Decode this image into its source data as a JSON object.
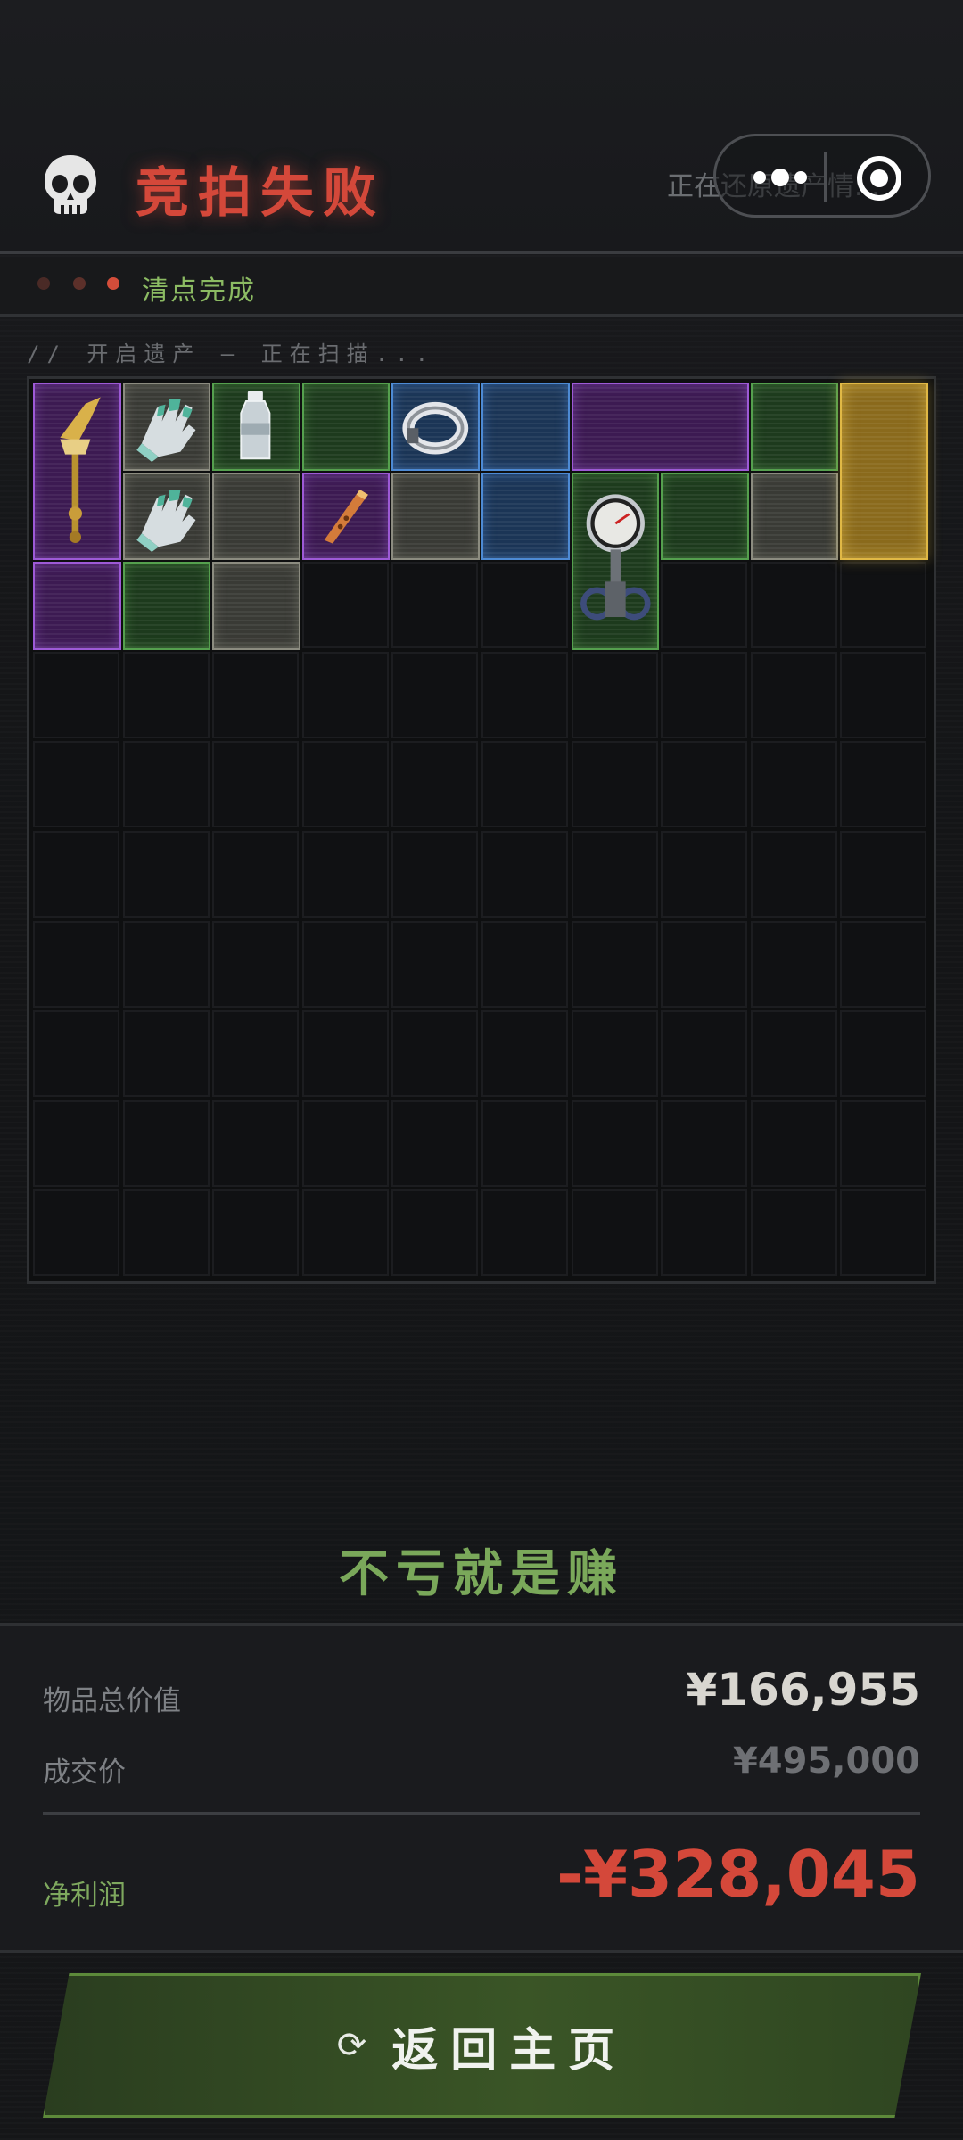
{
  "header": {
    "title": "竞拍失败",
    "status_text": "正在还原遗产情...",
    "skull_icon": "skull-icon",
    "capsule": {
      "more_icon": "more-dots-icon",
      "close_icon": "target-circle-icon"
    }
  },
  "stage": {
    "dots": [
      {
        "state": "done",
        "color": "#4a2a26"
      },
      {
        "state": "done",
        "color": "#5c302a"
      },
      {
        "state": "active",
        "color": "#d44d3a"
      }
    ],
    "label": "清点完成"
  },
  "scan": {
    "text": "// 开启遗产 – 正在扫描..."
  },
  "grid": {
    "columns": 10,
    "rows": 10,
    "items": [
      {
        "rarity": "purple",
        "icon": "golden-scepter-icon",
        "col": 0,
        "row": 0,
        "w": 1,
        "h": 2
      },
      {
        "rarity": "purple",
        "icon": "",
        "col": 0,
        "row": 2,
        "w": 1,
        "h": 1
      },
      {
        "rarity": "gray",
        "icon": "glove-icon",
        "col": 1,
        "row": 0,
        "w": 1,
        "h": 1
      },
      {
        "rarity": "gray",
        "icon": "glove-icon",
        "col": 1,
        "row": 1,
        "w": 1,
        "h": 1
      },
      {
        "rarity": "green",
        "icon": "",
        "col": 1,
        "row": 2,
        "w": 1,
        "h": 1
      },
      {
        "rarity": "green",
        "icon": "water-bottle-icon",
        "col": 2,
        "row": 0,
        "w": 1,
        "h": 1
      },
      {
        "rarity": "gray",
        "icon": "",
        "col": 2,
        "row": 1,
        "w": 1,
        "h": 1
      },
      {
        "rarity": "gray",
        "icon": "",
        "col": 2,
        "row": 2,
        "w": 1,
        "h": 1
      },
      {
        "rarity": "green",
        "icon": "",
        "col": 3,
        "row": 0,
        "w": 1,
        "h": 1
      },
      {
        "rarity": "purple",
        "icon": "flute-icon",
        "col": 3,
        "row": 1,
        "w": 1,
        "h": 1
      },
      {
        "rarity": "blue",
        "icon": "metal-ring-icon",
        "col": 4,
        "row": 0,
        "w": 1,
        "h": 1
      },
      {
        "rarity": "gray",
        "icon": "",
        "col": 4,
        "row": 1,
        "w": 1,
        "h": 1
      },
      {
        "rarity": "blue",
        "icon": "",
        "col": 5,
        "row": 0,
        "w": 1,
        "h": 1
      },
      {
        "rarity": "blue",
        "icon": "",
        "col": 5,
        "row": 1,
        "w": 1,
        "h": 1
      },
      {
        "rarity": "purple",
        "icon": "",
        "col": 6,
        "row": 0,
        "w": 2,
        "h": 1
      },
      {
        "rarity": "green",
        "icon": "pressure-gauge-icon",
        "col": 6,
        "row": 1,
        "w": 1,
        "h": 2
      },
      {
        "rarity": "green",
        "icon": "",
        "col": 7,
        "row": 1,
        "w": 1,
        "h": 1
      },
      {
        "rarity": "green",
        "icon": "",
        "col": 8,
        "row": 0,
        "w": 1,
        "h": 1
      },
      {
        "rarity": "gray",
        "icon": "",
        "col": 8,
        "row": 1,
        "w": 1,
        "h": 1
      },
      {
        "rarity": "gold",
        "icon": "",
        "col": 9,
        "row": 0,
        "w": 1,
        "h": 2
      }
    ]
  },
  "slogan": "不亏就是赚",
  "summary": {
    "total_label": "物品总价值",
    "total_value": "¥166,955",
    "deal_label": "成交价",
    "deal_value": "¥495,000",
    "profit_label": "净利润",
    "profit_value": "-¥328,045"
  },
  "colors": {
    "accent_red": "#d4483a",
    "accent_green": "#8cbb63",
    "rarity_purple": "#9d5ad6",
    "rarity_green": "#55a04e",
    "rarity_blue": "#4d8ad4",
    "rarity_gray": "#8c8c80",
    "rarity_gold": "#e0b845"
  },
  "button": {
    "label": "返回主页",
    "icon": "refresh-icon",
    "icon_glyph": "⟳"
  }
}
